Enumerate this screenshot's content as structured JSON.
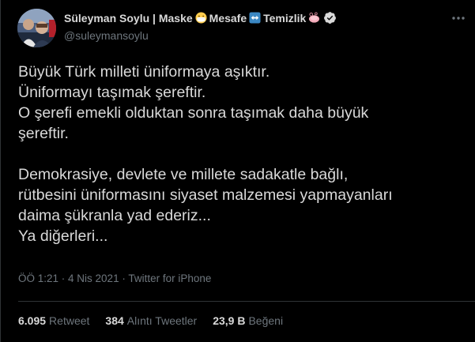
{
  "author": {
    "display_name_parts": [
      "Süleyman Soylu | Maske",
      "Mesafe",
      "Temizlik"
    ],
    "handle": "@suleymansoylu",
    "avatar_icon": "profile-photo",
    "emojis": [
      "mask-emoji",
      "left-right-arrow-emoji",
      "soap-emoji"
    ],
    "verified": true
  },
  "tweet": {
    "lines": [
      "Büyük Türk milleti üniformaya aşıktır.",
      "Üniformayı taşımak şereftir.",
      "O şerefi emekli olduktan sonra taşımak daha büyük",
      "şereftir.",
      "",
      "Demokrasiye, devlete ve millete sadakatle bağlı,",
      "rütbesini üniformasını siyaset malzemesi yapmayanları",
      "daima şükranla yad ederiz...",
      "Ya diğerleri..."
    ],
    "time": "ÖÖ 1:21",
    "separator": " · ",
    "date": "4 Nis 2021",
    "source": "Twitter for iPhone"
  },
  "stats": {
    "retweets_count": "6.095",
    "retweets_label": "Retweet",
    "quotes_count": "384",
    "quotes_label": "Alıntı Tweetler",
    "likes_count": "23,9 B",
    "likes_label": "Beğeni"
  },
  "colors": {
    "background": "#000000",
    "text": "#d9d9d9",
    "muted": "#6e767d",
    "divider": "#2f3336"
  }
}
